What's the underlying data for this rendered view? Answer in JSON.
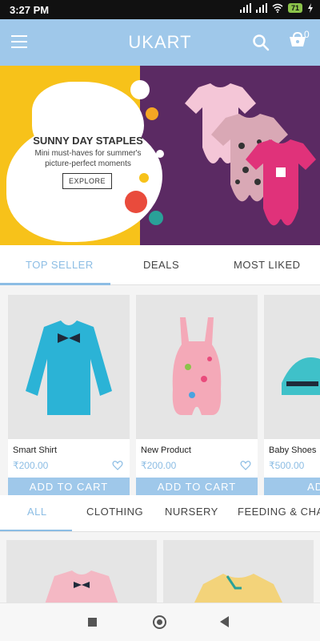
{
  "status": {
    "time": "3:27 PM",
    "battery": "71"
  },
  "header": {
    "title": "UKART",
    "cart_count": "0"
  },
  "banner": {
    "title": "SUNNY DAY STAPLES",
    "subtitle_line1": "Mini must-haves for summer's",
    "subtitle_line2": "picture-perfect moments",
    "cta": "EXPLORE"
  },
  "top_tabs": [
    "TOP SELLER",
    "DEALS",
    "MOST LIKED"
  ],
  "products": [
    {
      "name": "Smart Shirt",
      "price": "₹200.00",
      "cta": "ADD TO CART"
    },
    {
      "name": "New Product",
      "price": "₹200.00",
      "cta": "ADD TO CART"
    },
    {
      "name": "Baby Shoes",
      "price": "₹500.00",
      "cta": "ADD T"
    }
  ],
  "category_tabs": [
    "ALL",
    "CLOTHING",
    "NURSERY",
    "FEEDING & CHAN"
  ],
  "colors": {
    "accent": "#9fc8ea",
    "price": "#8cbde4",
    "banner_bg": "#5b2a63",
    "banner_yellow": "#f7c21a"
  },
  "icons": [
    "menu-icon",
    "search-icon",
    "cart-icon",
    "heart-icon",
    "square-nav-icon",
    "home-nav-icon",
    "back-nav-icon"
  ]
}
